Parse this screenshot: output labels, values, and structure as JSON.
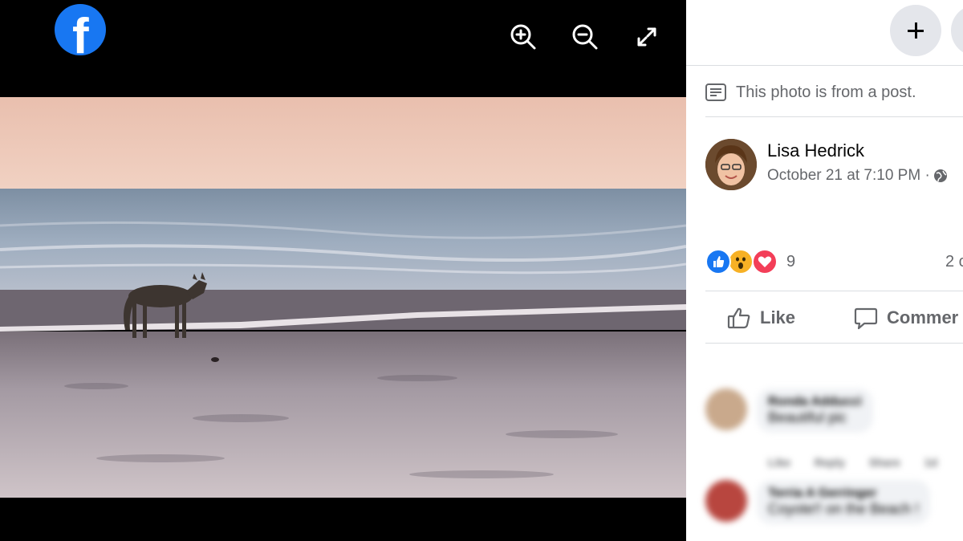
{
  "viewer": {
    "logo_letter": "f",
    "tools": [
      "zoom-in",
      "zoom-out",
      "fullscreen"
    ]
  },
  "panel": {
    "from_post_text": "This photo is from a post.",
    "author": {
      "name": "Lisa Hedrick",
      "meta": "October 21 at 7:10 PM ·"
    },
    "reactions": {
      "icons": [
        "like",
        "wow",
        "love"
      ],
      "count": "9",
      "comments_count": "2 c"
    },
    "actions": {
      "like_label": "Like",
      "comment_label": "Commer"
    },
    "comments": [
      {
        "name": "Ronda Adducci",
        "text": "Beautiful pic",
        "links": "Like Reply Share 1d"
      },
      {
        "name": "Terria A Gerringer",
        "text": "Coyote!! on the Beach !"
      }
    ]
  },
  "colors": {
    "facebook_blue": "#1877f2",
    "secondary_text": "#65676b",
    "love_red": "#f33e58",
    "wow_yellow": "#f7b125"
  }
}
